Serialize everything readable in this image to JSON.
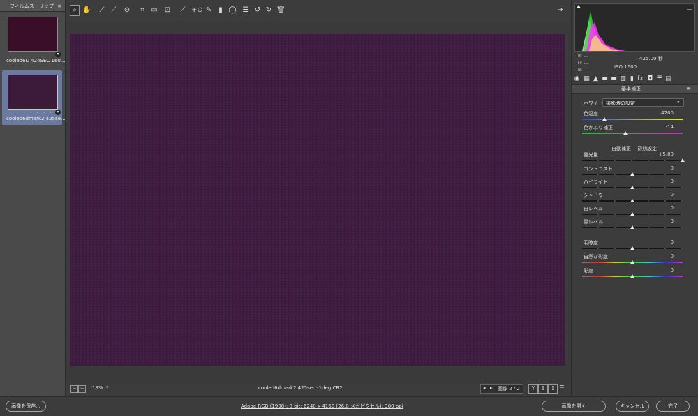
{
  "filmstrip": {
    "title": "フィルムストリップ",
    "menu_icon": "≡",
    "items": [
      {
        "label": "cooled6D 424SEC 160...",
        "badge": "▾"
      },
      {
        "label": "cooled6dmark2 425se...",
        "dots": "• • • • •",
        "badge": "▾"
      }
    ]
  },
  "toolbar": {
    "icons": [
      "zoom-icon",
      "hand-icon",
      "white-balance-icon",
      "color-sampler-icon",
      "target-adjustment-icon",
      "crop-icon",
      "straighten-icon",
      "transform-icon",
      "spot-removal-icon",
      "red-eye-icon",
      "adjustment-brush-icon",
      "graduated-filter-icon",
      "radial-filter-icon",
      "preferences-icon",
      "rotate-left-icon",
      "rotate-right-icon",
      "trash-icon"
    ],
    "glyphs": [
      "⌕",
      "✋",
      "⟋",
      "⟋",
      "⊙",
      "⌗",
      "▭",
      "⊡",
      "⟋",
      "+⊙",
      "✎",
      "▮",
      "◯",
      "☰",
      "↺",
      "↻",
      "🗑"
    ],
    "open_glyph": "⇥"
  },
  "status": {
    "zoom": "19%",
    "zoom_dropdown": "▾",
    "filename": "cooled6dmark2 425sec -1deg.CR2",
    "image_counter": "画像 2 / 2",
    "prev": "◂",
    "next": "▸",
    "view_y": "Y",
    "view_buttons": [
      "⇕",
      "↕",
      "☰"
    ]
  },
  "readout": {
    "r": "R:   ---",
    "g": "G:   ---",
    "b": "B:   ---",
    "shutter": "425.00 秒",
    "iso": "ISO 1600"
  },
  "panel": {
    "title": "基本補正",
    "menu": "≡",
    "tab_glyphs": [
      "◉",
      "▦",
      "▲",
      "▬",
      "▬",
      "▥",
      "▮",
      "fx",
      "◘",
      "☰",
      "▤"
    ],
    "white_balance_label": "ホワイトバランス：",
    "white_balance_value": "撮影時の設定",
    "white_balance_arrow": "▾",
    "auto_label": "自動補正",
    "default_label": "初期設定",
    "sliders": [
      {
        "label": "色温度",
        "value": "4200",
        "pos": 0.22,
        "track": "temp"
      },
      {
        "label": "色かぶり補正",
        "value": "-14",
        "pos": 0.43,
        "track": "tint"
      },
      {
        "label": "露光量",
        "value": "+5.00",
        "pos": 1.0,
        "track": "default"
      },
      {
        "label": "コントラスト",
        "value": "0",
        "pos": 0.5,
        "track": "default"
      },
      {
        "label": "ハイライト",
        "value": "0",
        "pos": 0.5,
        "track": "default"
      },
      {
        "label": "シャドウ",
        "value": "0",
        "pos": 0.5,
        "track": "default"
      },
      {
        "label": "白レベル",
        "value": "0",
        "pos": 0.5,
        "track": "default"
      },
      {
        "label": "黒レベル",
        "value": "0",
        "pos": 0.5,
        "track": "default"
      },
      {
        "label": "明瞭度",
        "value": "0",
        "pos": 0.5,
        "track": "default"
      },
      {
        "label": "自然な彩度",
        "value": "0",
        "pos": 0.5,
        "track": "vibrance"
      },
      {
        "label": "彩度",
        "value": "0",
        "pos": 0.5,
        "track": "saturation"
      }
    ]
  },
  "bottom": {
    "save": "画像を保存...",
    "workflow": "Adobe RGB (1998); 8 bit; 6240 x 4160 (26.0 メガピクセル); 300 ppi",
    "open": "画像を開く",
    "cancel": "キャンセル",
    "done": "完了"
  },
  "colors": {
    "photo": "#3a1d3d",
    "accent_selection": "#6a7aa0"
  }
}
